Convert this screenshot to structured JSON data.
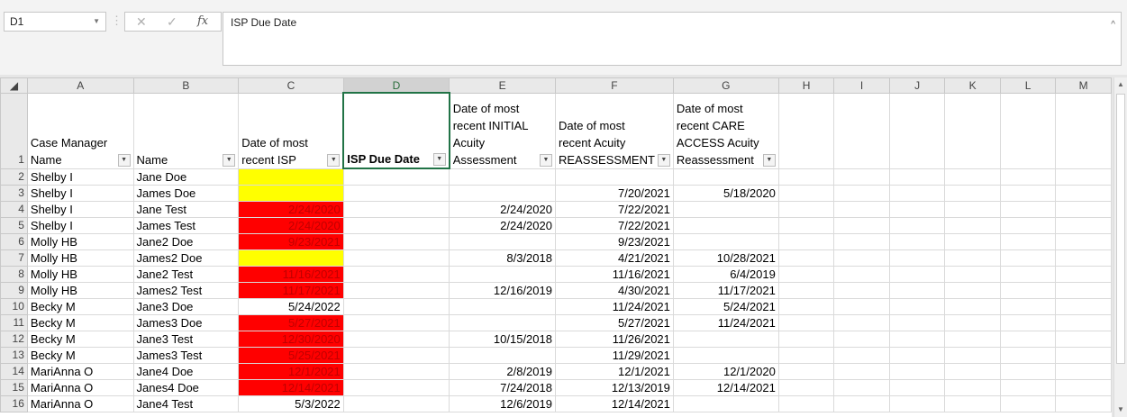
{
  "formula_bar": {
    "name_box": "D1",
    "cancel_icon": "✕",
    "enter_icon": "✓",
    "fx_label": "fx",
    "formula": "ISP Due Date"
  },
  "columns": [
    "A",
    "B",
    "C",
    "D",
    "E",
    "F",
    "G",
    "H",
    "I",
    "J",
    "K",
    "L",
    "M"
  ],
  "selected_column": "D",
  "headers": [
    "Case Manager Name",
    "Name",
    "Date of most recent ISP",
    "ISP Due Date",
    "Date of most recent INITIAL Acuity Assessment",
    "Date of most recent Acuity REASSESSMENT",
    "Date of most recent CARE ACCESS Acuity Reassessment"
  ],
  "rows": [
    {
      "n": "2",
      "a": "Shelby I",
      "b": "Jane Doe",
      "c": "",
      "c_fill": "yellow",
      "d": "",
      "e": "",
      "f": "",
      "g": ""
    },
    {
      "n": "3",
      "a": "Shelby I",
      "b": "James Doe",
      "c": "",
      "c_fill": "yellow",
      "d": "",
      "e": "",
      "f": "7/20/2021",
      "g": "5/18/2020"
    },
    {
      "n": "4",
      "a": "Shelby I",
      "b": "Jane Test",
      "c": "2/24/2020",
      "c_fill": "red",
      "d": "",
      "e": "2/24/2020",
      "f": "7/22/2021",
      "g": ""
    },
    {
      "n": "5",
      "a": "Shelby I",
      "b": "James Test",
      "c": "2/24/2020",
      "c_fill": "red",
      "d": "",
      "e": "2/24/2020",
      "f": "7/22/2021",
      "g": ""
    },
    {
      "n": "6",
      "a": "Molly HB",
      "b": "Jane2 Doe",
      "c": "9/23/2021",
      "c_fill": "red",
      "d": "",
      "e": "",
      "f": "9/23/2021",
      "g": ""
    },
    {
      "n": "7",
      "a": "Molly HB",
      "b": "James2 Doe",
      "c": "",
      "c_fill": "yellow",
      "d": "",
      "e": "8/3/2018",
      "f": "4/21/2021",
      "g": "10/28/2021"
    },
    {
      "n": "8",
      "a": "Molly HB",
      "b": "Jane2 Test",
      "c": "11/16/2021",
      "c_fill": "red",
      "d": "",
      "e": "",
      "f": "11/16/2021",
      "g": "6/4/2019"
    },
    {
      "n": "9",
      "a": "Molly HB",
      "b": "James2 Test",
      "c": "11/17/2021",
      "c_fill": "red",
      "d": "",
      "e": "12/16/2019",
      "f": "4/30/2021",
      "g": "11/17/2021"
    },
    {
      "n": "10",
      "a": "Becky M",
      "b": "Jane3 Doe",
      "c": "5/24/2022",
      "c_fill": "none",
      "d": "",
      "e": "",
      "f": "11/24/2021",
      "g": "5/24/2021"
    },
    {
      "n": "11",
      "a": "Becky M",
      "b": "James3 Doe",
      "c": "5/27/2021",
      "c_fill": "red",
      "d": "",
      "e": "",
      "f": "5/27/2021",
      "g": "11/24/2021"
    },
    {
      "n": "12",
      "a": "Becky M",
      "b": "Jane3 Test",
      "c": "12/30/2020",
      "c_fill": "red",
      "d": "",
      "e": "10/15/2018",
      "f": "11/26/2021",
      "g": ""
    },
    {
      "n": "13",
      "a": "Becky M",
      "b": "James3 Test",
      "c": "5/25/2021",
      "c_fill": "red",
      "d": "",
      "e": "",
      "f": "11/29/2021",
      "g": ""
    },
    {
      "n": "14",
      "a": "MariAnna O",
      "b": "Jane4 Doe",
      "c": "12/1/2021",
      "c_fill": "red",
      "d": "",
      "e": "2/8/2019",
      "f": "12/1/2021",
      "g": "12/1/2020"
    },
    {
      "n": "15",
      "a": "MariAnna O",
      "b": "Janes4 Doe",
      "c": "12/14/2021",
      "c_fill": "red",
      "d": "",
      "e": "7/24/2018",
      "f": "12/13/2019",
      "g": "12/14/2021"
    },
    {
      "n": "16",
      "a": "MariAnna O",
      "b": "Jane4 Test",
      "c": "5/3/2022",
      "c_fill": "none",
      "d": "",
      "e": "12/6/2019",
      "f": "12/14/2021",
      "g": ""
    }
  ],
  "colors": {
    "red_fill": "#ff0000",
    "yellow_fill": "#ffff00",
    "selection": "#217346"
  }
}
